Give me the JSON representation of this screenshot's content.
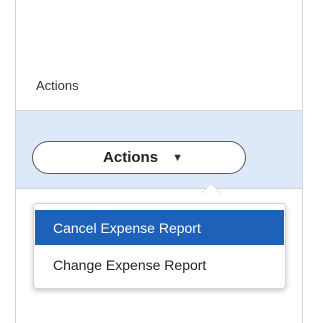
{
  "table": {
    "column_header": "Actions"
  },
  "row": {
    "actions_button_label": "Actions",
    "dropdown_icon": "chevron-down-icon"
  },
  "menu": {
    "items": [
      {
        "label": "Cancel Expense Report",
        "selected": true
      },
      {
        "label": "Change Expense Report",
        "selected": false
      }
    ]
  },
  "colors": {
    "row_highlight": "#dde8f8",
    "menu_selected": "#1e61b8"
  }
}
